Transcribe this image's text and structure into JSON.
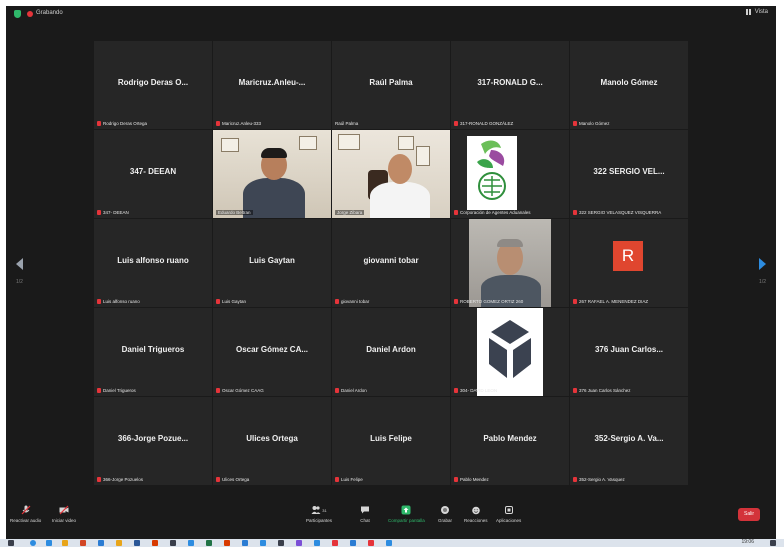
{
  "topbar": {
    "recording_label": "Grabando",
    "view_label": "Vista"
  },
  "tiles": [
    {
      "name": "Rodrigo Deras O...",
      "label": "Rodrigo Deras Ortega"
    },
    {
      "name": "Maricruz.Anleu-...",
      "label": "Maricruz.Anleu-333"
    },
    {
      "name": "Raúl Palma",
      "label": "Raúl Palma"
    },
    {
      "name": "317-RONALD G...",
      "label": "317-RONALD GONZÁLEZ"
    },
    {
      "name": "Manolo Gómez",
      "label": "Manolo Gómez"
    },
    {
      "name": "347- DEEAN",
      "label": "347- DEEAN"
    },
    {
      "name": "",
      "label": "Eduardo Beltran"
    },
    {
      "name": "",
      "label": "Jorge Zibara"
    },
    {
      "name": "",
      "label": "Corporación de Agentes Aduanales"
    },
    {
      "name": "322 SERGIO VEL...",
      "label": "322 SERGIO VELASQUEZ VISQUERRA"
    },
    {
      "name": "Luis alfonso ruano",
      "label": "Luis alfonso ruano"
    },
    {
      "name": "Luis Gaytan",
      "label": "Luis Gaytan"
    },
    {
      "name": "giovanni tobar",
      "label": "giovanni tobar"
    },
    {
      "name": "",
      "label": "ROBERTO GOMEZ ORTIZ 260"
    },
    {
      "name": "",
      "label": "267 RAFAEL A. MENENDEZ DIAZ",
      "avatar": "R"
    },
    {
      "name": "Daniel Trigueros",
      "label": "Daniel Trigueros"
    },
    {
      "name": "Oscar Gómez CA...",
      "label": "Oscar Gómez CAAG"
    },
    {
      "name": "Daniel Ardon",
      "label": "Daniel Ardon"
    },
    {
      "name": "",
      "label": "304- DAVID LEON"
    },
    {
      "name": "376 Juan Carlos...",
      "label": "376 Juan Carlos Sánchez"
    },
    {
      "name": "366-Jorge Pozue...",
      "label": "366-Jorge Pozuelos"
    },
    {
      "name": "Ulices Ortega",
      "label": "Ulices Ortega"
    },
    {
      "name": "Luis Felipe",
      "label": "Luis Felipe"
    },
    {
      "name": "Pablo Mendez",
      "label": "Pablo Mendez"
    },
    {
      "name": "352-Sergio A. Va...",
      "label": "352-Sergio A. Vasquez"
    }
  ],
  "pager": {
    "left": "1/2",
    "right": "1/2"
  },
  "toolbar": {
    "audio_label": "Reactivar audio",
    "video_label": "Iniciar video",
    "participants_label": "Participantes",
    "participants_count": "31",
    "chat_label": "Chat",
    "share_label": "Compartir pantalla",
    "record_label": "Grabar",
    "reactions_label": "Reacciones",
    "apps_label": "Aplicaciones",
    "exit_label": "Salir"
  },
  "taskbar": {
    "clock": "19:06"
  },
  "colors": {
    "accent_green": "#2fb86b",
    "mute_red": "#e5343a",
    "active_border": "#e8e15a",
    "exit_red": "#d3333a",
    "avatar_bg": "#e0462f"
  }
}
